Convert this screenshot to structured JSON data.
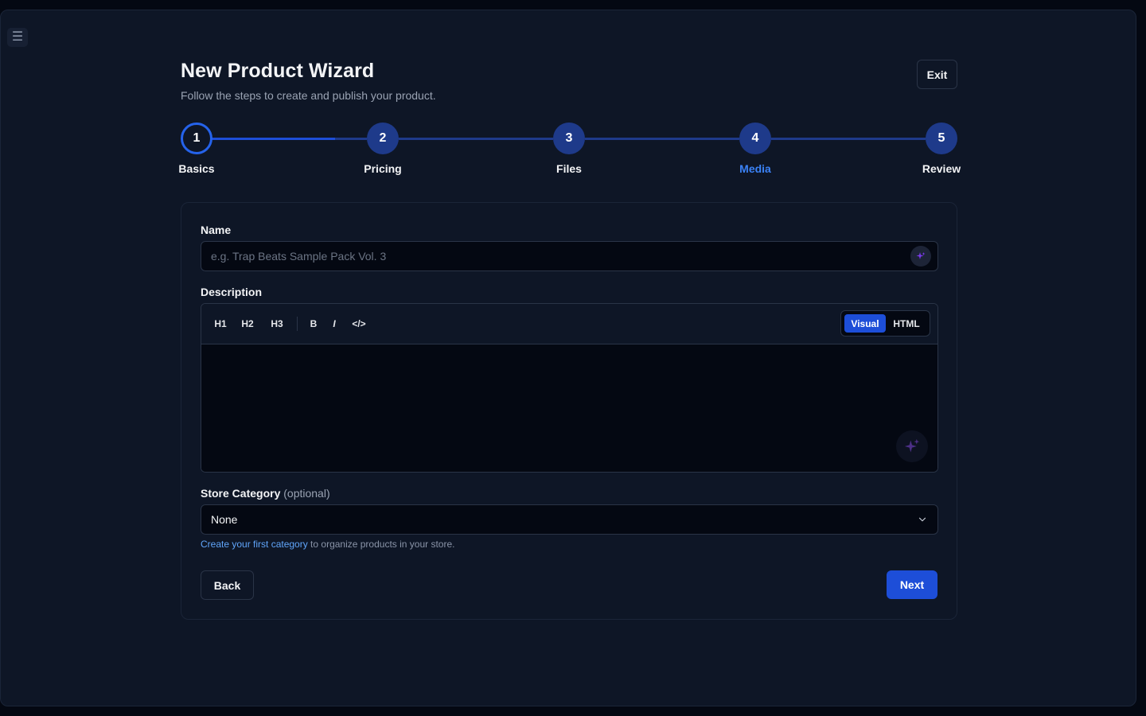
{
  "app": {
    "menu_icon": "hamburger-menu-icon",
    "colors": {
      "background": "#040812",
      "panel": "#0e1626",
      "accent": "#1d4ed8",
      "active_step_label": "#3b82f6",
      "link": "#60a5fa"
    }
  },
  "header": {
    "title": "New Product Wizard",
    "subtitle": "Follow the steps to create and publish your product.",
    "exit_label": "Exit"
  },
  "stepper": {
    "steps": [
      {
        "number": "1",
        "label": "Basics",
        "state": "current"
      },
      {
        "number": "2",
        "label": "Pricing",
        "state": "upcoming"
      },
      {
        "number": "3",
        "label": "Files",
        "state": "upcoming"
      },
      {
        "number": "4",
        "label": "Media",
        "state": "highlighted"
      },
      {
        "number": "5",
        "label": "Review",
        "state": "upcoming"
      }
    ]
  },
  "form": {
    "name": {
      "label": "Name",
      "value": "",
      "placeholder": "e.g. Trap Beats Sample Pack Vol. 3",
      "ai_icon": "sparkle-icon"
    },
    "description": {
      "label": "Description",
      "toolbar": {
        "h1": "H1",
        "h2": "H2",
        "h3": "H3",
        "bold": "B",
        "italic": "I",
        "code": "</>"
      },
      "modes": {
        "visual": "Visual",
        "html": "HTML",
        "selected": "Visual"
      },
      "content": "",
      "ai_icon": "sparkle-icon"
    },
    "category": {
      "label": "Store Category",
      "optional": "(optional)",
      "selected": "None",
      "helper_link": "Create your first category",
      "helper_text": " to organize products in your store."
    }
  },
  "actions": {
    "back": "Back",
    "next": "Next"
  }
}
